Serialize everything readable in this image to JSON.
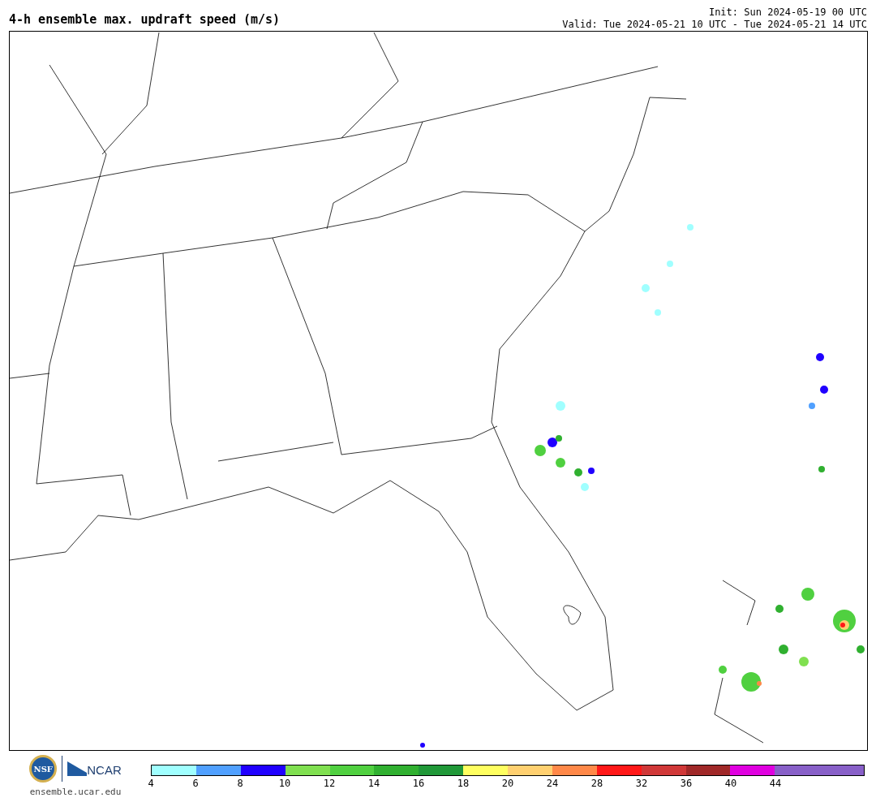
{
  "title": "4-h ensemble max. updraft speed (m/s)",
  "init": "Init: Sun 2024-05-19 00 UTC",
  "valid": "Valid: Tue 2024-05-21 10 UTC - Tue 2024-05-21 14 UTC",
  "logos": {
    "nsf": "NSF",
    "ncar": "NCAR",
    "url": "ensemble.ucar.edu"
  },
  "colorbar": {
    "bins": [
      {
        "color": "#a0ffff"
      },
      {
        "color": "#50a0ff"
      },
      {
        "color": "#2000ff"
      },
      {
        "color": "#80e050"
      },
      {
        "color": "#50d040"
      },
      {
        "color": "#30b030"
      },
      {
        "color": "#209838"
      },
      {
        "color": "#ffff60"
      },
      {
        "color": "#ffd070"
      },
      {
        "color": "#ff8848"
      },
      {
        "color": "#ff1818"
      },
      {
        "color": "#d03838"
      },
      {
        "color": "#a02828"
      },
      {
        "color": "#e000e0"
      },
      {
        "color": "#8860c8"
      },
      {
        "color": "#8860c8"
      }
    ],
    "ticks": [
      "4",
      "6",
      "8",
      "10",
      "12",
      "14",
      "16",
      "18",
      "20",
      "24",
      "28",
      "32",
      "36",
      "40",
      "44"
    ]
  }
}
